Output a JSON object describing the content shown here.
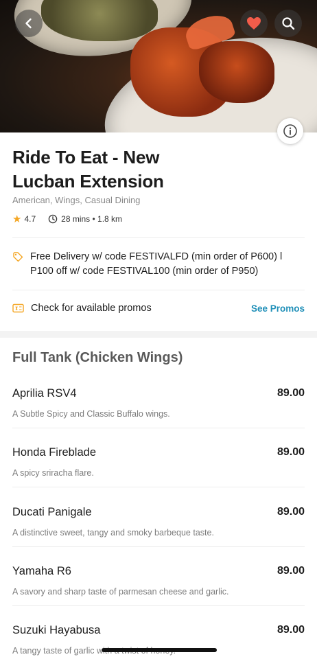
{
  "hero": {
    "icons": {
      "back": "chevron-left-icon",
      "favorite": "heart-icon",
      "search": "search-icon",
      "info": "info-icon"
    },
    "favorite_color": "#f25c4a"
  },
  "restaurant": {
    "name_line1": "Ride To Eat - New",
    "name_line2": "Lucban Extension",
    "cuisines": "American, Wings, Casual Dining",
    "rating": "4.7",
    "eta_distance": "28 mins • 1.8 km"
  },
  "promos": {
    "offer_line1": "Free Delivery w/ code FESTIVALFD (min order of P600) l",
    "offer_line2": "P100 off w/ code FESTIVAL100 (min order of P950)",
    "check_label": "Check for available promos",
    "see_promos_label": "See Promos",
    "accent_color": "#f4a623",
    "link_color": "#1f8fb8"
  },
  "menu": {
    "section_title": "Full Tank (Chicken Wings)",
    "items": [
      {
        "name": "Aprilia RSV4",
        "price": "89.00",
        "desc": "A Subtle Spicy and Classic Buffalo wings."
      },
      {
        "name": "Honda Fireblade",
        "price": "89.00",
        "desc": "A spicy sriracha flare."
      },
      {
        "name": "Ducati Panigale",
        "price": "89.00",
        "desc": "A distinctive sweet, tangy and smoky barbeque taste."
      },
      {
        "name": "Yamaha R6",
        "price": "89.00",
        "desc": "A savory and sharp taste of parmesan cheese and garlic."
      },
      {
        "name": "Suzuki Hayabusa",
        "price": "89.00",
        "desc": "A tangy taste of garlic with a twist of honey."
      }
    ]
  }
}
